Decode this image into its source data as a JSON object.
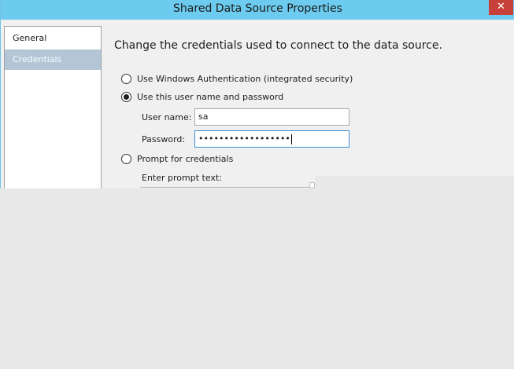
{
  "window": {
    "title": "Shared Data Source Properties",
    "close_glyph": "✕"
  },
  "nav": {
    "items": [
      {
        "label": "General",
        "selected": false
      },
      {
        "label": "Credentials",
        "selected": true
      }
    ]
  },
  "main": {
    "heading": "Change the credentials used to connect to the data source.",
    "options": [
      {
        "label": "Use Windows Authentication (integrated security)",
        "checked": false
      },
      {
        "label": "Use this user name and password",
        "checked": true
      },
      {
        "label": "Prompt for credentials",
        "checked": false
      }
    ],
    "username_label": "User name:",
    "username_value": "sa",
    "password_label": "Password:",
    "password_value": "••••••••••••••••••",
    "prompt_label": "Enter prompt text:"
  },
  "colors": {
    "titlebar": "#6ccbee",
    "close": "#c7413a",
    "selected_nav": "#b4c6d6"
  },
  "icons": [
    "close-icon",
    "radio-icon"
  ]
}
